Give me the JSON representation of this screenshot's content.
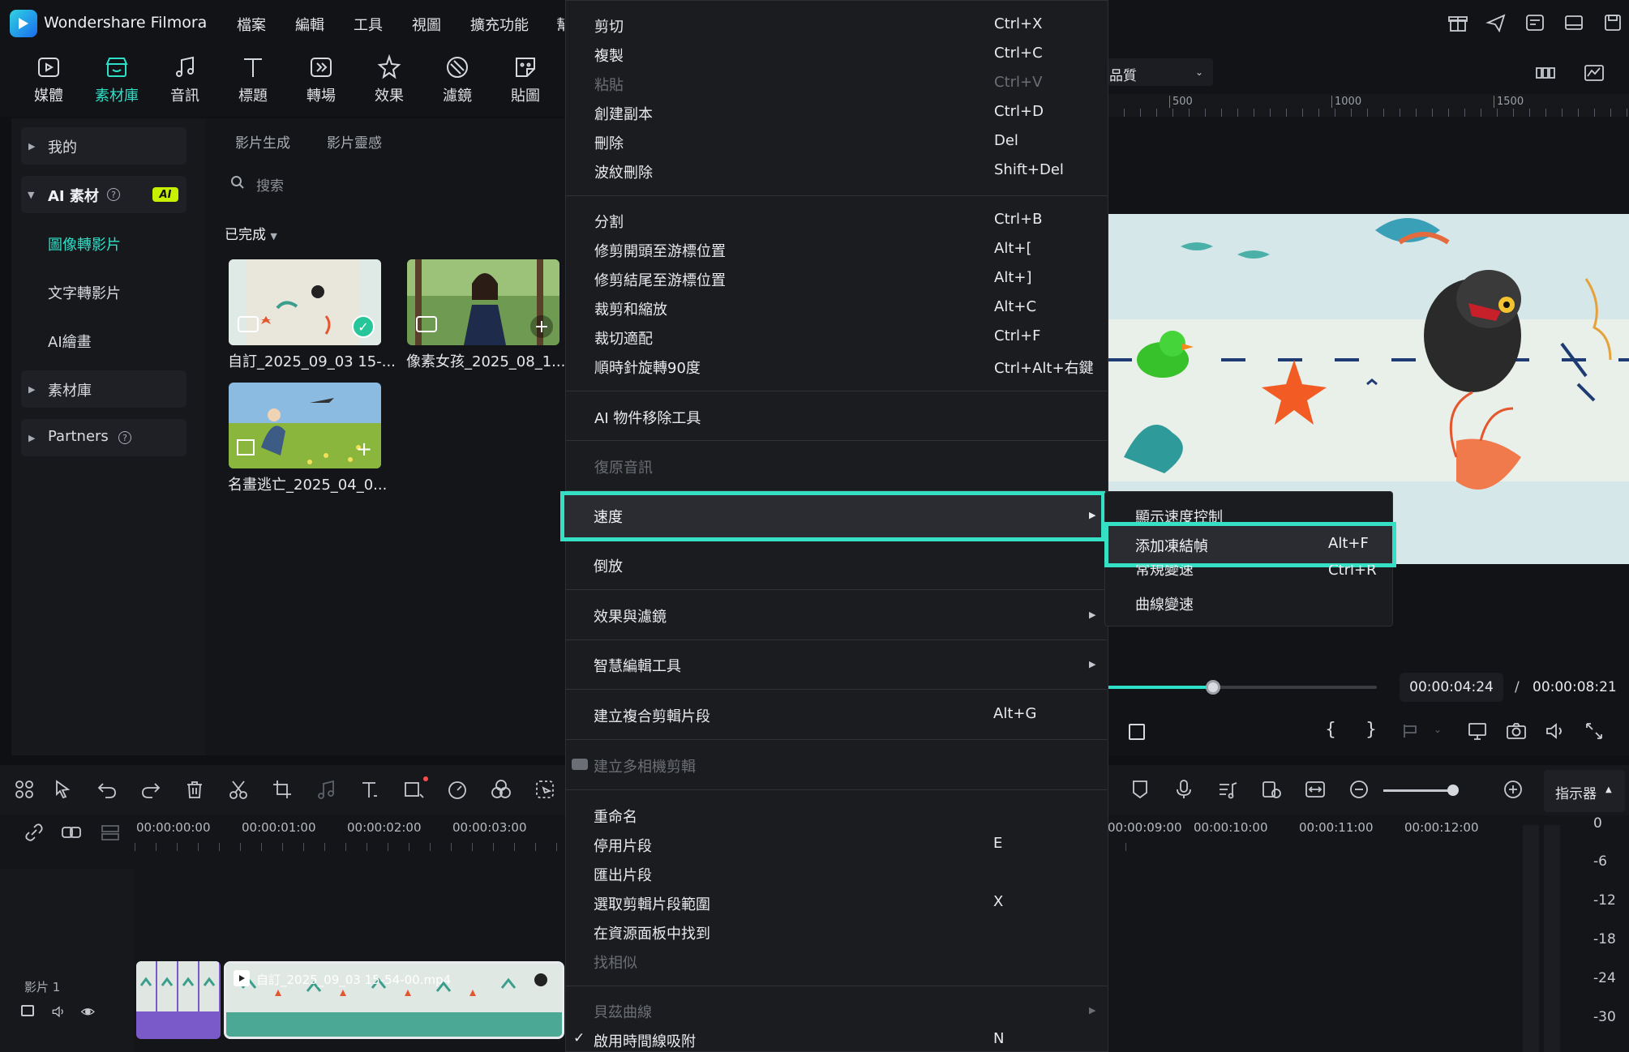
{
  "app": {
    "name": "Wondershare Filmora"
  },
  "menubar": [
    "檔案",
    "編輯",
    "工具",
    "視圖",
    "擴充功能",
    "幫"
  ],
  "toolbar": [
    {
      "label": "媒體",
      "icon": "media-icon"
    },
    {
      "label": "素材庫",
      "icon": "store-icon",
      "active": true
    },
    {
      "label": "音訊",
      "icon": "music-icon"
    },
    {
      "label": "標題",
      "icon": "title-icon"
    },
    {
      "label": "轉場",
      "icon": "transition-icon"
    },
    {
      "label": "效果",
      "icon": "effects-icon"
    },
    {
      "label": "濾鏡",
      "icon": "filter-icon"
    },
    {
      "label": "貼圖",
      "icon": "sticker-icon"
    }
  ],
  "sidebar": {
    "mine": "我的",
    "ai_assets": "AI 素材",
    "ai_badge": "AI",
    "items": [
      "圖像轉影片",
      "文字轉影片",
      "AI繪畫"
    ],
    "library": "素材庫",
    "partners": "Partners"
  },
  "content": {
    "tabs": [
      "影片生成",
      "影片靈感"
    ],
    "search_placeholder": "搜索",
    "filter": "已完成",
    "clips": [
      {
        "name": "自訂_2025_09_03 15-..."
      },
      {
        "name": "像素女孩_2025_08_1..."
      },
      {
        "name": "名畫逃亡_2025_04_0..."
      }
    ]
  },
  "preview": {
    "quality": "品質",
    "ruler": [
      "500",
      "1000",
      "1500"
    ],
    "current_time": "00:00:04:24",
    "separator": "/",
    "total_time": "00:00:08:21",
    "progress": 0.52,
    "brackets": [
      "{",
      "}"
    ]
  },
  "timeline": {
    "timecodes": [
      "00:00:00:00",
      "00:00:01:00",
      "00:00:02:00",
      "00:00:03:00"
    ],
    "timecodes_right": [
      "00:00:09:00",
      "00:00:10:00",
      "00:00:11:00",
      "00:00:12:00"
    ],
    "track_label": "影片 1",
    "clip_name": "自訂_2025_09_03 15-54-00.mp4",
    "indicator": "指示器",
    "vu_scale": [
      "0",
      "-6",
      "-12",
      "-18",
      "-24",
      "-30"
    ]
  },
  "context_menu": {
    "items": [
      {
        "label": "剪切",
        "shortcut": "Ctrl+X"
      },
      {
        "label": "複製",
        "shortcut": "Ctrl+C"
      },
      {
        "label": "粘貼",
        "shortcut": "Ctrl+V",
        "disabled": true
      },
      {
        "label": "創建副本",
        "shortcut": "Ctrl+D"
      },
      {
        "label": "刪除",
        "shortcut": "Del"
      },
      {
        "label": "波紋刪除",
        "shortcut": "Shift+Del"
      },
      {
        "label": "分割",
        "shortcut": "Ctrl+B"
      },
      {
        "label": "修剪開頭至游標位置",
        "shortcut": "Alt+["
      },
      {
        "label": "修剪結尾至游標位置",
        "shortcut": "Alt+]"
      },
      {
        "label": "裁剪和縮放",
        "shortcut": "Alt+C"
      },
      {
        "label": "裁切適配",
        "shortcut": "Ctrl+F"
      },
      {
        "label": "順時針旋轉90度",
        "shortcut": "Ctrl+Alt+右鍵"
      },
      {
        "label": "AI 物件移除工具",
        "shortcut": ""
      },
      {
        "label": "復原音訊",
        "shortcut": "",
        "disabled": true
      },
      {
        "label": "速度",
        "shortcut": "",
        "submenu": true
      },
      {
        "label": "倒放",
        "shortcut": ""
      },
      {
        "label": "效果與濾鏡",
        "shortcut": "",
        "submenu": true
      },
      {
        "label": "智慧編輯工具",
        "shortcut": "",
        "submenu": true
      },
      {
        "label": "建立複合剪輯片段",
        "shortcut": "Alt+G"
      },
      {
        "label": "建立多相機剪輯",
        "shortcut": "",
        "disabled": true
      },
      {
        "label": "重命名",
        "shortcut": ""
      },
      {
        "label": "停用片段",
        "shortcut": "E"
      },
      {
        "label": "匯出片段",
        "shortcut": ""
      },
      {
        "label": "選取剪輯片段範圍",
        "shortcut": "X"
      },
      {
        "label": "在資源面板中找到",
        "shortcut": ""
      },
      {
        "label": "找相似",
        "shortcut": "",
        "disabled": true
      },
      {
        "label": "貝茲曲線",
        "shortcut": "",
        "disabled": true,
        "submenu": true
      },
      {
        "label": "啟用時間線吸附",
        "shortcut": "N",
        "checked": true
      }
    ]
  },
  "speed_submenu": {
    "items": [
      {
        "label": "顯示速度控制",
        "shortcut": ""
      },
      {
        "label": "添加凍結幀",
        "shortcut": "Alt+F"
      },
      {
        "label": "常規變速",
        "shortcut": "Ctrl+R"
      },
      {
        "label": "曲線變速",
        "shortcut": ""
      }
    ]
  },
  "colors": {
    "accent": "#2fe0c8",
    "highlight": "#35e0c5",
    "background": "#0f1013",
    "menu": "#1b1c20"
  }
}
